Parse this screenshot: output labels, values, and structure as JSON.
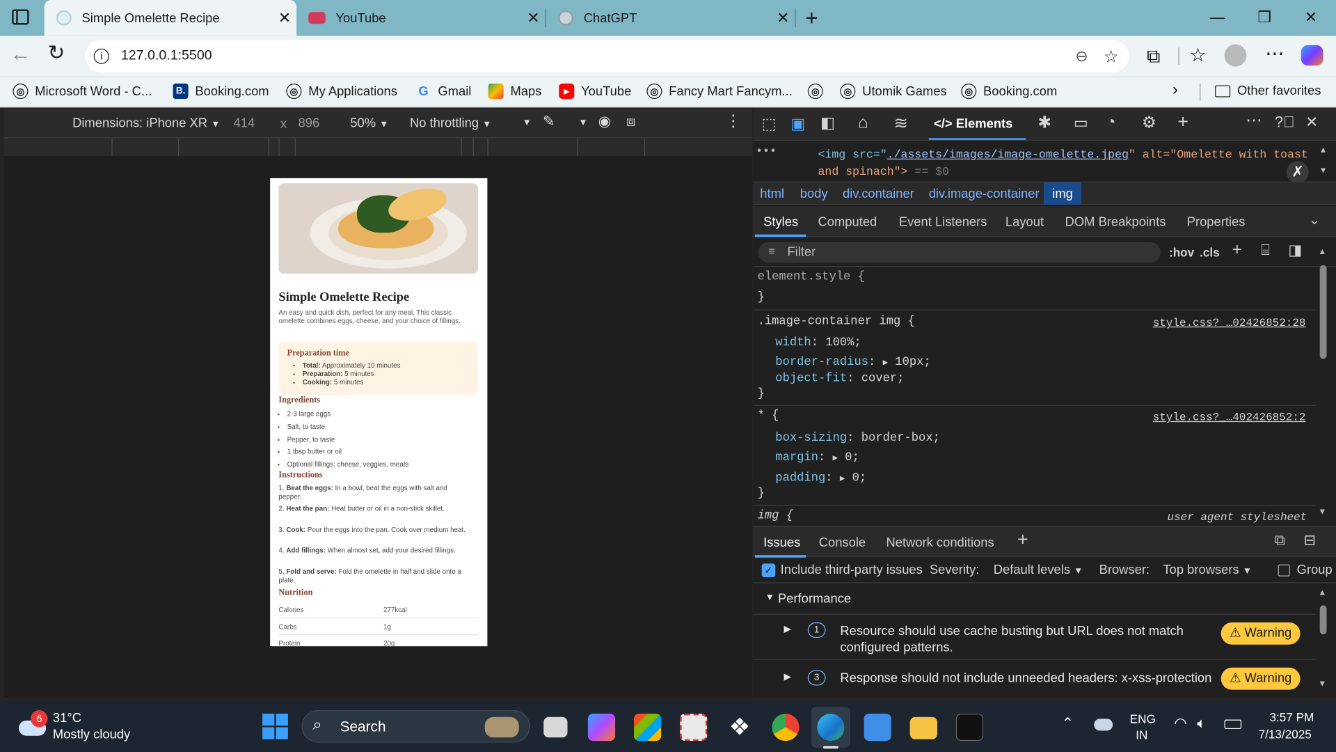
{
  "tabs": [
    {
      "title": "Simple Omelette Recipe",
      "favicon": "edge-swirl-icon",
      "active": true
    },
    {
      "title": "YouTube",
      "favicon": "youtube-icon"
    },
    {
      "title": "ChatGPT",
      "favicon": "chatgpt-icon"
    }
  ],
  "address": {
    "url": "127.0.0.1:5500"
  },
  "bookmarks": [
    {
      "label": "Microsoft Word - C...",
      "icon": "globe-icon"
    },
    {
      "label": "Booking.com",
      "icon": "booking-icon",
      "glyph": "B."
    },
    {
      "label": "My Applications",
      "icon": "globe-icon"
    },
    {
      "label": "Gmail",
      "icon": "google-icon",
      "glyph": "G"
    },
    {
      "label": "Maps",
      "icon": "maps-icon"
    },
    {
      "label": "YouTube",
      "icon": "youtube-icon"
    },
    {
      "label": "Fancy Mart Fancym...",
      "icon": "globe-icon"
    },
    {
      "label": "",
      "icon": "globe-icon"
    },
    {
      "label": "Utomik Games",
      "icon": "globe-icon"
    },
    {
      "label": "Booking.com",
      "icon": "globe-icon"
    }
  ],
  "other_favorites": "Other favorites",
  "device": {
    "dimensions": "Dimensions: iPhone XR",
    "width": "414",
    "times": "x",
    "height": "896",
    "zoom": "50%",
    "throttle": "No throttling"
  },
  "recipe": {
    "title": "Simple Omelette Recipe",
    "intro": "An easy and quick dish, perfect for any meal. This classic omelette combines eggs, cheese, and your choice of fillings.",
    "prep_heading": "Preparation time",
    "prep": [
      {
        "k": "Total:",
        "v": " Approximately 10 minutes"
      },
      {
        "k": "Preparation:",
        "v": " 5 minutes"
      },
      {
        "k": "Cooking:",
        "v": " 5 minutes"
      }
    ],
    "ingredients_heading": "Ingredients",
    "ingredients": [
      "2-3 large eggs",
      "Salt, to taste",
      "Pepper, to taste",
      "1 tbsp butter or oil",
      "Optional fillings: cheese, veggies, meats"
    ],
    "instructions_heading": "Instructions",
    "instructions": [
      {
        "n": "1.",
        "k": "Beat the eggs:",
        "v": " In a bowl, beat the eggs with salt and pepper."
      },
      {
        "n": "2.",
        "k": "Heat the pan:",
        "v": " Heat butter or oil in a non-stick skillet."
      },
      {
        "n": "3.",
        "k": "Cook:",
        "v": " Pour the eggs into the pan. Cook over medium heat."
      },
      {
        "n": "4.",
        "k": "Add fillings:",
        "v": " When almost set, add your desired fillings."
      },
      {
        "n": "5.",
        "k": "Fold and serve:",
        "v": " Fold the omelette in half and slide onto a plate."
      }
    ],
    "nutrition_heading": "Nutrition",
    "nutrition": [
      {
        "k": "Calories",
        "v": "277kcal"
      },
      {
        "k": "Carbs",
        "v": "1g"
      },
      {
        "k": "Protein",
        "v": "20g"
      }
    ]
  },
  "devtools": {
    "tool_tabs": {
      "elements": "Elements"
    },
    "html_line1": "<img src=\"",
    "html_src": "./assets/images/image-omelette.jpeg",
    "html_line1b": "\" alt=\"Omelette with toast",
    "html_line2": "and spinach\">",
    "html_eq": "== $0",
    "breadcrumbs": [
      "html",
      "body",
      "div.container",
      "div.image-container",
      "img"
    ],
    "panel_tabs": [
      "Styles",
      "Computed",
      "Event Listeners",
      "Layout",
      "DOM Breakpoints",
      "Properties"
    ],
    "filter_placeholder": "Filter",
    "hov": ":hov",
    "cls": ".cls",
    "element_style": "element.style {",
    "close_brace": "}",
    "rule1_selector": ".image-container img {",
    "rule1_source": "style.css?_…02426852:28",
    "rule1_props": [
      {
        "p": "width",
        "v": "100%;",
        "tri": false
      },
      {
        "p": "border-radius",
        "v": "10px;",
        "tri": true
      },
      {
        "p": "object-fit",
        "v": "cover;",
        "tri": false
      }
    ],
    "rule2_selector": "* {",
    "rule2_source": "style.css?_…402426852:2",
    "rule2_props": [
      {
        "p": "box-sizing",
        "v": "border-box;",
        "tri": false
      },
      {
        "p": "margin",
        "v": "0;",
        "tri": true
      },
      {
        "p": "padding",
        "v": "0;",
        "tri": true
      }
    ],
    "rule3_selector": "img {",
    "rule3_source": "user agent stylesheet",
    "drawer_tabs": [
      "Issues",
      "Console",
      "Network conditions"
    ],
    "include_third_party": "Include third-party issues",
    "severity_label": "Severity:",
    "severity_value": "Default levels",
    "browser_label": "Browser:",
    "browser_value": "Top browsers",
    "group_label": "Group",
    "performance": "Performance",
    "issues": [
      {
        "count": "1",
        "text": "Resource should use cache busting but URL does not match configured patterns.",
        "badge": "Warning"
      },
      {
        "count": "3",
        "text": "Response should not include unneeded headers: x-xss-protection",
        "badge": "Warning"
      }
    ]
  },
  "taskbar": {
    "weather_badge": "6",
    "temp": "31°C",
    "condition": "Mostly cloudy",
    "search": "Search",
    "lang1": "ENG",
    "lang2": "IN",
    "time": "3:57 PM",
    "date": "7/13/2025"
  },
  "colors": {
    "accent": "#2196f3",
    "warning": "#ffc83d",
    "tabbar": "#7fb7c4",
    "prep_bg": "#fff4e4",
    "recipe_heading": "#854632"
  }
}
